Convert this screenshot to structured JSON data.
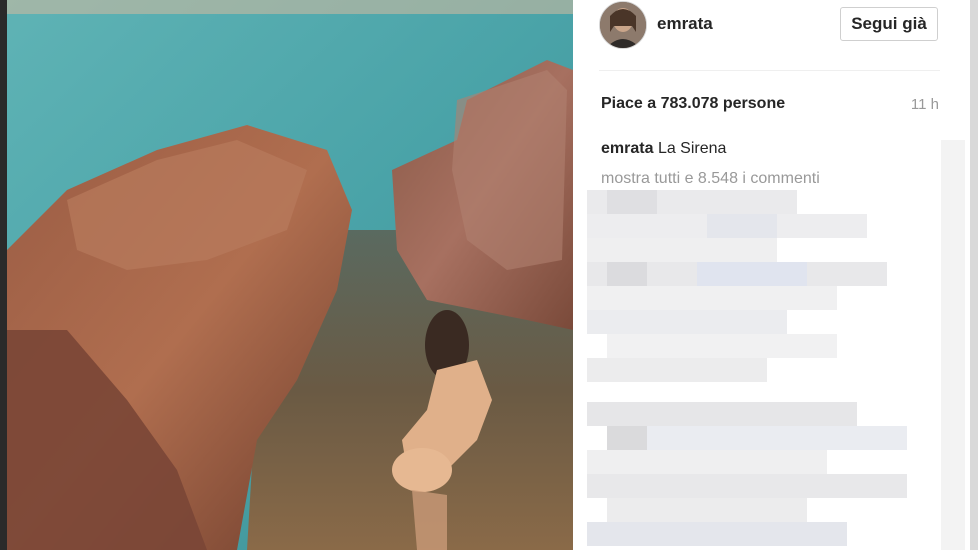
{
  "post": {
    "username": "emrata",
    "follow_label": "Segui già",
    "likes_text": "Piace a 783.078 persone",
    "time_ago": "11 h",
    "caption_user": "emrata",
    "caption_text": "La Sirena",
    "show_comments": "mostra tutti e 8.548 i commenti"
  },
  "colors": {
    "text_primary": "#262626",
    "text_secondary": "#999999",
    "button_border": "#cfcfcf",
    "panel_bg": "#ffffff"
  },
  "icons": {
    "avatar": "profile-photo"
  }
}
